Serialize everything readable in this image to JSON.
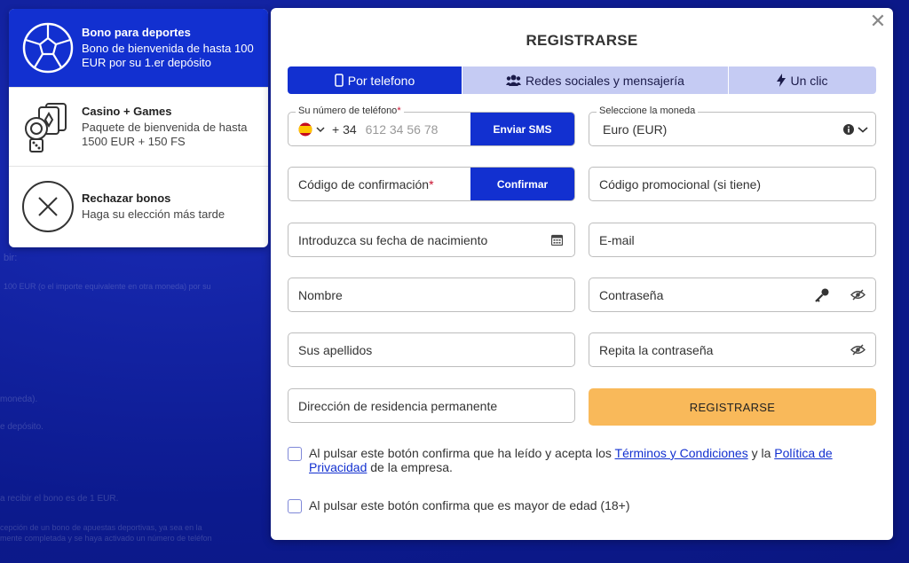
{
  "background": {
    "lines": [
      "bir:",
      "100 EUR (o el importe equivalente en otra moneda) por su",
      "moneda).",
      "e depósito.",
      "a recibir el bono es de 1 EUR.",
      "cepción de un bono de apuestas deportivas, ya sea en la",
      "mente completada y se haya activado un número de teléfon"
    ]
  },
  "bonus": {
    "items": [
      {
        "icon": "soccer-ball-icon",
        "title": "Bono para deportes",
        "desc": "Bono de bienvenida de hasta 100 EUR por su 1.er depósito"
      },
      {
        "icon": "casino-chips-icon",
        "title": "Casino + Games",
        "desc": "Paquete de bienvenida de hasta 1500 EUR + 150 FS"
      },
      {
        "icon": "reject-icon",
        "title": "Rechazar bonos",
        "desc": "Haga su elección más tarde"
      }
    ]
  },
  "modal": {
    "close_icon": "close-icon",
    "title": "REGISTRARSE",
    "tabs": [
      {
        "label": "Por telefono",
        "icon": "phone-icon"
      },
      {
        "label": "Redes sociales y mensajería",
        "icon": "users-icon"
      },
      {
        "label": "Un clic",
        "icon": "lightning-icon"
      }
    ],
    "phone": {
      "label": "Su número de teléfono",
      "prefix": "+ 34",
      "placeholder": "612 34 56 78",
      "send_button": "Enviar SMS"
    },
    "currency": {
      "label": "Seleccione la moneda",
      "value": "Euro (EUR)"
    },
    "confirmation": {
      "placeholder": "Código de confirmación",
      "button": "Confirmar"
    },
    "promo": {
      "placeholder": "Código promocional (si tiene)"
    },
    "birthdate": {
      "placeholder": "Introduzca su fecha de nacimiento"
    },
    "email": {
      "placeholder": "E-mail"
    },
    "name": {
      "placeholder": "Nombre"
    },
    "password": {
      "placeholder": "Contraseña"
    },
    "surname": {
      "placeholder": "Sus apellidos"
    },
    "repeat_password": {
      "placeholder": "Repita la contraseña"
    },
    "address": {
      "placeholder": "Dirección de residencia permanente"
    },
    "register_button": "REGISTRARSE",
    "terms": {
      "prefix": "Al pulsar este botón confirma que ha leído y acepta los",
      "terms_link": "Términos y Condiciones",
      "and": "y la",
      "privacy_link": "Política de Privacidad",
      "suffix": "de la empresa."
    },
    "age": "Al pulsar este botón confirma que es mayor de edad (18+)"
  },
  "colors": {
    "primary": "#1230d0",
    "register": "#f9b95a",
    "background": "#0f1fa0"
  }
}
